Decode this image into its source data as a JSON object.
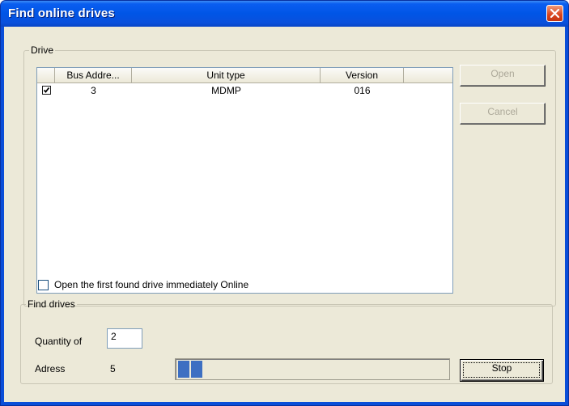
{
  "window": {
    "title": "Find online drives"
  },
  "drive_group": {
    "legend": "Drive",
    "columns": [
      "",
      "Bus Addre...",
      "Unit type",
      "Version",
      ""
    ],
    "rows": [
      {
        "checked": true,
        "bus_address": "3",
        "unit_type": "MDMP",
        "version": "016"
      }
    ],
    "open_online_checkbox": {
      "label": "Open the first found drive immediately Online",
      "checked": false
    }
  },
  "buttons": {
    "open": "Open",
    "cancel": "Cancel",
    "stop": "Stop"
  },
  "find_group": {
    "legend": "Find drives",
    "quantity_label": "Quantity of",
    "quantity_value": "2",
    "address_label": "Adress",
    "address_value": "5",
    "progress_segments": 2
  },
  "colors": {
    "title_bar": "#0a5ef0",
    "dialog_bg": "#ece9d8",
    "progress": "#3d6fc2",
    "close_button": "#d9431c"
  }
}
